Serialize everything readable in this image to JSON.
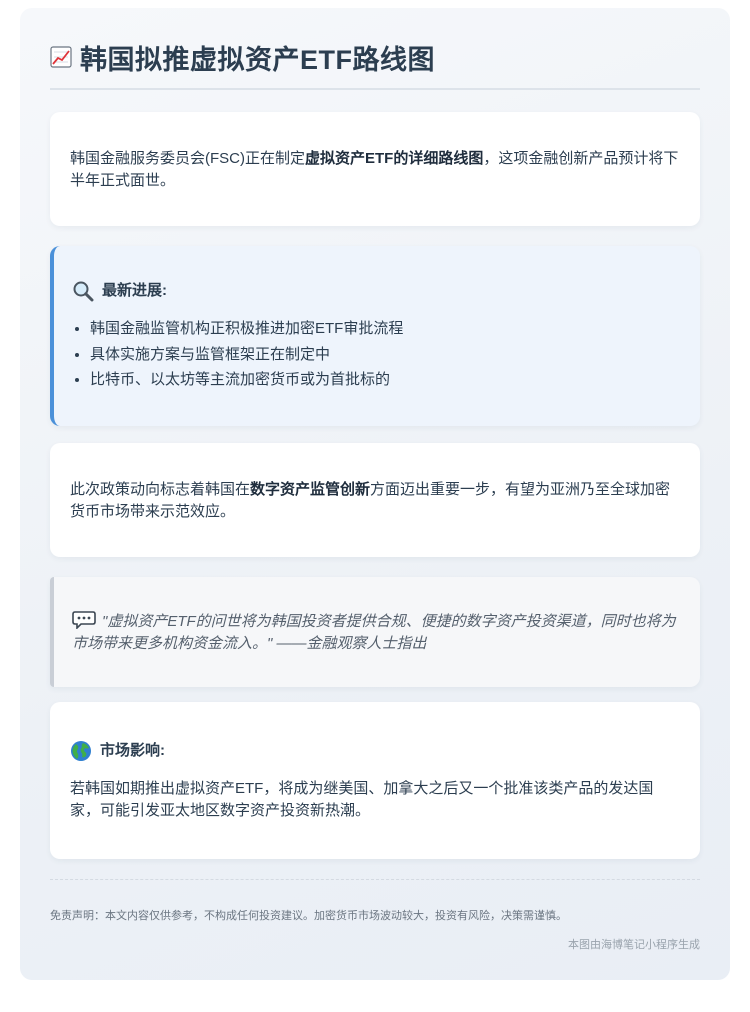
{
  "header": {
    "icon": "chart-increasing-icon",
    "title": "韩国拟推虚拟资产ETF路线图"
  },
  "intro": {
    "before": "韩国金融服务委员会(FSC)正在制定",
    "bold": "虚拟资产ETF的详细路线图",
    "after": "，这项金融创新产品预计将下半年正式面世。"
  },
  "progress": {
    "icon": "magnifier-icon",
    "heading": "最新进展:",
    "items": [
      "韩国金融监管机构正积极推进加密ETF审批流程",
      "具体实施方案与监管框架正在制定中",
      "比特币、以太坊等主流加密货币或为首批标的"
    ]
  },
  "significance": {
    "before": "此次政策动向标志着韩国在",
    "bold": "数字资产监管创新",
    "after": "方面迈出重要一步，有望为亚洲乃至全球加密货币市场带来示范效应。"
  },
  "quote": {
    "icon": "speech-bubble-icon",
    "text": "\"虚拟资产ETF的问世将为韩国投资者提供合规、便捷的数字资产投资渠道，同时也将为市场带来更多机构资金流入。\" ——金融观察人士指出"
  },
  "impact": {
    "icon": "globe-icon",
    "heading": "市场影响:",
    "text": "若韩国如期推出虚拟资产ETF，将成为继美国、加拿大之后又一个批准该类产品的发达国家，可能引发亚太地区数字资产投资新热潮。"
  },
  "footer": {
    "disclaimer": "免责声明：本文内容仅供参考，不构成任何投资建议。加密货币市场波动较大，投资有风险，决策需谨慎。",
    "credit": "本图由海博笔记小程序生成"
  },
  "colors": {
    "accent": "#4a90d9",
    "title": "#2c3e50",
    "quote_border": "#c9ced6"
  }
}
